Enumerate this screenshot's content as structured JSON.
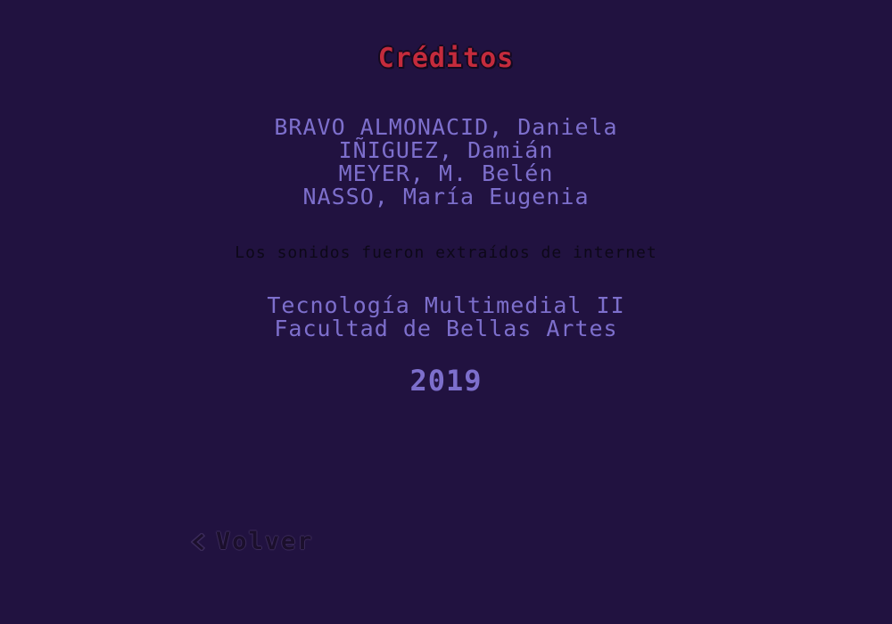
{
  "screen": {
    "title": "Créditos",
    "authors": [
      "BRAVO ALMONACID, Daniela",
      "IÑIGUEZ, Damián",
      "MEYER, M. Belén",
      "NASSO, María Eugenia"
    ],
    "sounds_note": "Los sonidos fueron extraídos de internet",
    "institution": {
      "course": "Tecnología Multimedial II",
      "faculty": "Facultad de Bellas Artes"
    },
    "year": "2019",
    "back_label": "Volver",
    "back_icon": "chevron-left-icon"
  },
  "colors": {
    "background": "#211240",
    "title": "#c42b3c",
    "body_text": "#7d6fcc",
    "dark_text": "#0d0818"
  }
}
